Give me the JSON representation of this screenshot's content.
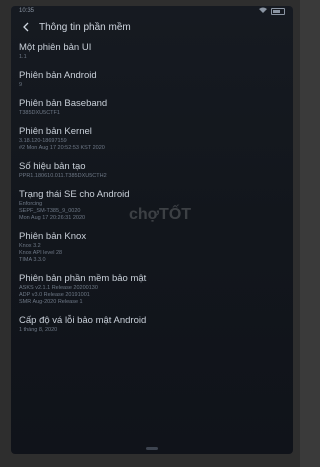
{
  "status": {
    "time": "10:35"
  },
  "header": {
    "title": "Thông tin phần mềm"
  },
  "items": [
    {
      "label": "Một phiên bản UI",
      "values": [
        "1.1"
      ]
    },
    {
      "label": "Phiên bản Android",
      "values": [
        "9"
      ]
    },
    {
      "label": "Phiên bản Baseband",
      "values": [
        "T385DXU5CTF1"
      ]
    },
    {
      "label": "Phiên bản Kernel",
      "values": [
        "3.18.120-18697159",
        "#2 Mon Aug 17 20:52:53 KST 2020"
      ]
    },
    {
      "label": "Số hiệu bản tạo",
      "values": [
        "PPR1.180610.011.T385DXU5CTH2"
      ]
    },
    {
      "label": "Trạng thái SE cho Android",
      "values": [
        "Enforcing",
        "SEPF_SM-T385_9_0020",
        "Mon Aug 17 20:26:31 2020"
      ]
    },
    {
      "label": "Phiên bản Knox",
      "values": [
        "Knox 3.2",
        "Knox API level 28",
        "TIMA 3.3.0"
      ]
    },
    {
      "label": "Phiên bản phần mềm bảo mật",
      "values": [
        "ASKS v2.1.1 Release 20200130",
        "ADP v3.0 Release 20191001",
        "SMR Aug-2020 Release 1"
      ]
    },
    {
      "label": "Cấp độ vá lỗi bảo mật Android",
      "values": [
        "1 tháng 8, 2020"
      ]
    }
  ],
  "watermark": "chợTỐT"
}
